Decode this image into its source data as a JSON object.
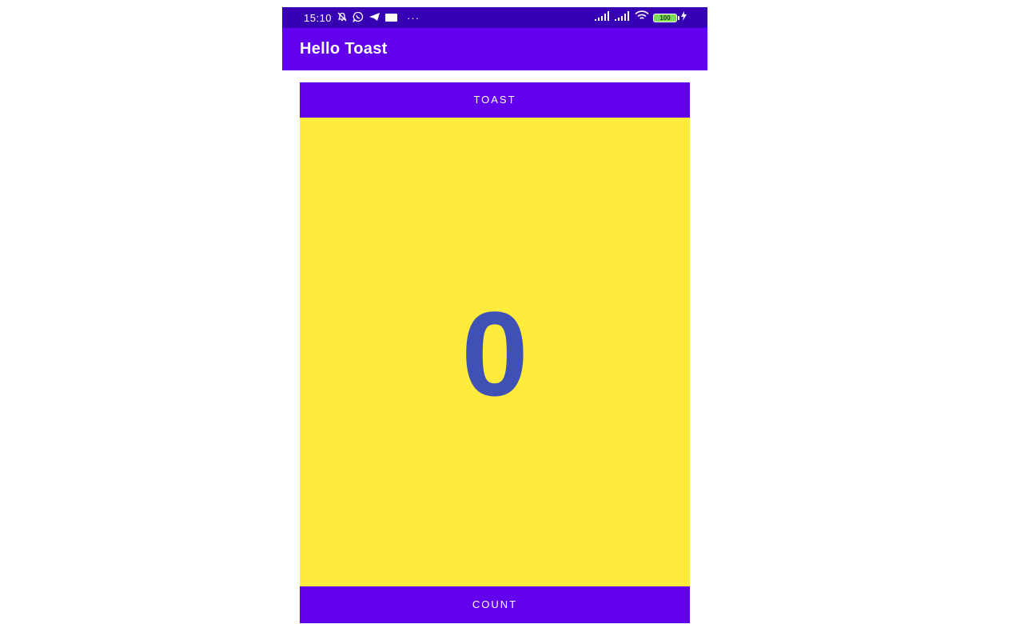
{
  "status_bar": {
    "time": "15:10",
    "battery_level": "100",
    "overflow": "···",
    "icons": [
      "bell-off-icon",
      "whatsapp-icon",
      "telegram-icon",
      "notification-tile-icon",
      "signal-icon",
      "signal-icon",
      "wifi-icon",
      "battery-icon",
      "charging-icon"
    ]
  },
  "app_bar": {
    "title": "Hello Toast"
  },
  "buttons": {
    "toast_label": "TOAST",
    "count_label": "COUNT"
  },
  "counter": {
    "value": "0"
  },
  "colors": {
    "status_bar": "#3700b3",
    "primary": "#6200ee",
    "count_background": "#ffeb3b",
    "count_text": "#3f51b5"
  }
}
